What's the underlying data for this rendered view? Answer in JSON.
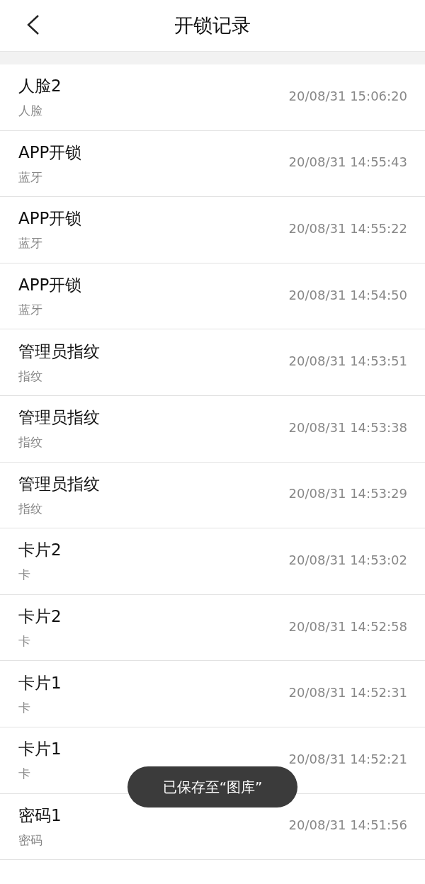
{
  "header": {
    "title": "开锁记录"
  },
  "records": [
    {
      "name": "人脸2",
      "method": "人脸",
      "time": "20/08/31 15:06:20"
    },
    {
      "name": "APP开锁",
      "method": "蓝牙",
      "time": "20/08/31 14:55:43"
    },
    {
      "name": "APP开锁",
      "method": "蓝牙",
      "time": "20/08/31 14:55:22"
    },
    {
      "name": "APP开锁",
      "method": "蓝牙",
      "time": "20/08/31 14:54:50"
    },
    {
      "name": "管理员指纹",
      "method": "指纹",
      "time": "20/08/31 14:53:51"
    },
    {
      "name": "管理员指纹",
      "method": "指纹",
      "time": "20/08/31 14:53:38"
    },
    {
      "name": "管理员指纹",
      "method": "指纹",
      "time": "20/08/31 14:53:29"
    },
    {
      "name": "卡片2",
      "method": "卡",
      "time": "20/08/31 14:53:02"
    },
    {
      "name": "卡片2",
      "method": "卡",
      "time": "20/08/31 14:52:58"
    },
    {
      "name": "卡片1",
      "method": "卡",
      "time": "20/08/31 14:52:31"
    },
    {
      "name": "卡片1",
      "method": "卡",
      "time": "20/08/31 14:52:21"
    },
    {
      "name": "密码1",
      "method": "密码",
      "time": "20/08/31 14:51:56"
    }
  ],
  "toast": {
    "text": "已保存至“图库”"
  }
}
